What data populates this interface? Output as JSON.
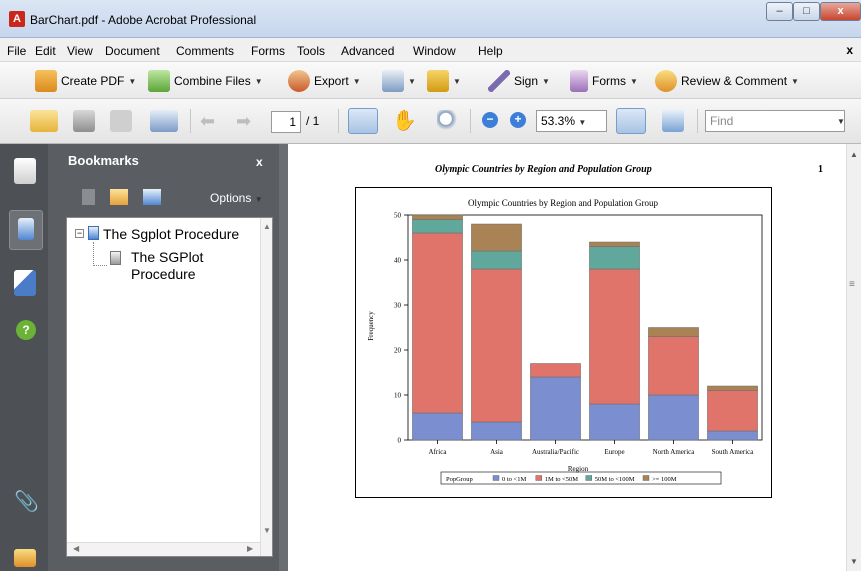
{
  "window": {
    "title": "BarChart.pdf - Adobe Acrobat Professional",
    "minimize": "–",
    "maximize": "□",
    "close": "x"
  },
  "menubar": {
    "items": [
      "File",
      "Edit",
      "View",
      "Document",
      "Comments",
      "Forms",
      "Tools",
      "Advanced",
      "Window",
      "Help"
    ],
    "close": "x"
  },
  "toolbar1": {
    "create_pdf": "Create PDF",
    "combine_files": "Combine Files",
    "export": "Export",
    "sign": "Sign",
    "forms": "Forms",
    "review_comment": "Review & Comment"
  },
  "toolbar2": {
    "page_current": "1",
    "page_total": "/ 1",
    "zoom": "53.3%",
    "find_placeholder": "Find"
  },
  "bookmarks": {
    "title": "Bookmarks",
    "close": "x",
    "options": "Options",
    "items": [
      {
        "label": "The Sgplot Procedure"
      },
      {
        "label_line1": "The SGPlot",
        "label_line2": "Procedure"
      }
    ]
  },
  "document": {
    "heading": "Olympic Countries by Region and Population Group",
    "page_number": "1"
  },
  "chart_data": {
    "type": "bar",
    "stacked": true,
    "title": "Olympic Countries by Region and Population Group",
    "xlabel": "Region",
    "ylabel": "Frequency",
    "ylim": [
      0,
      50
    ],
    "yticks": [
      0,
      10,
      20,
      30,
      40,
      50
    ],
    "categories": [
      "Africa",
      "Asia",
      "Australia/Pacific",
      "Europe",
      "North America",
      "South America"
    ],
    "legend_title": "PopGroup",
    "series": [
      {
        "name": "0 to <1M",
        "color": "#7b8fd0",
        "values": [
          6,
          4,
          14,
          8,
          10,
          2
        ]
      },
      {
        "name": "1M to <50M",
        "color": "#e0736a",
        "values": [
          40,
          34,
          3,
          30,
          13,
          9
        ]
      },
      {
        "name": "50M to <100M",
        "color": "#5fa89b",
        "values": [
          3,
          4,
          0,
          5,
          0,
          0
        ]
      },
      {
        "name": ">= 100M",
        "color": "#a98356",
        "values": [
          1,
          6,
          0,
          1,
          2,
          1
        ]
      }
    ],
    "grid": false,
    "legend_position": "bottom"
  }
}
